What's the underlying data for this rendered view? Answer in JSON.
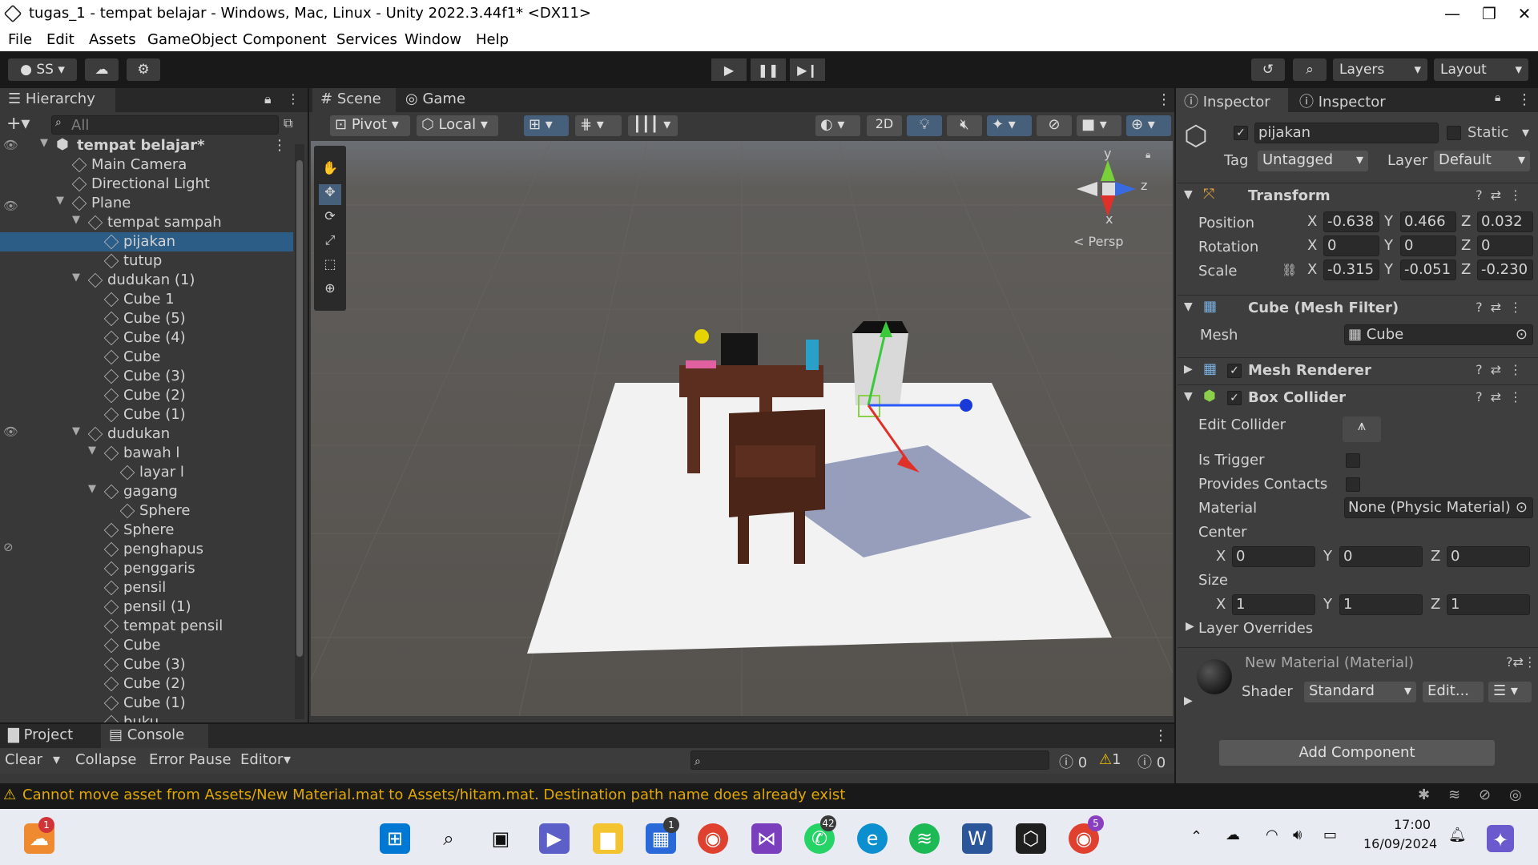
{
  "window": {
    "title": "tugas_1 - tempat belajar - Windows, Mac, Linux - Unity 2022.3.44f1* <DX11>"
  },
  "menu": [
    "File",
    "Edit",
    "Assets",
    "GameObject",
    "Component",
    "Services",
    "Window",
    "Help"
  ],
  "toolbar": {
    "account": "SS",
    "layers": "Layers",
    "layout": "Layout"
  },
  "hierarchy": {
    "tab": "Hierarchy",
    "search_placeholder": "All",
    "scene": "tempat belajar*",
    "items": [
      {
        "label": "Main Camera",
        "depth": 1
      },
      {
        "label": "Directional Light",
        "depth": 1
      },
      {
        "label": "Plane",
        "depth": 1,
        "expanded": true
      },
      {
        "label": "tempat sampah",
        "depth": 2,
        "expanded": true
      },
      {
        "label": "pijakan",
        "depth": 3,
        "selected": true
      },
      {
        "label": "tutup",
        "depth": 3
      },
      {
        "label": "dudukan (1)",
        "depth": 2,
        "expanded": true
      },
      {
        "label": "Cube 1",
        "depth": 3
      },
      {
        "label": "Cube (5)",
        "depth": 3
      },
      {
        "label": "Cube (4)",
        "depth": 3
      },
      {
        "label": "Cube",
        "depth": 3
      },
      {
        "label": "Cube (3)",
        "depth": 3
      },
      {
        "label": "Cube (2)",
        "depth": 3
      },
      {
        "label": "Cube (1)",
        "depth": 3
      },
      {
        "label": "dudukan",
        "depth": 2,
        "expanded": true
      },
      {
        "label": "bawah l",
        "depth": 3,
        "expanded": true
      },
      {
        "label": "layar l",
        "depth": 4
      },
      {
        "label": "gagang",
        "depth": 3,
        "expanded": true
      },
      {
        "label": "Sphere",
        "depth": 4
      },
      {
        "label": "Sphere",
        "depth": 3
      },
      {
        "label": "penghapus",
        "depth": 3
      },
      {
        "label": "penggaris",
        "depth": 3
      },
      {
        "label": "pensil",
        "depth": 3
      },
      {
        "label": "pensil (1)",
        "depth": 3
      },
      {
        "label": "tempat pensil",
        "depth": 3
      },
      {
        "label": "Cube",
        "depth": 3
      },
      {
        "label": "Cube (3)",
        "depth": 3
      },
      {
        "label": "Cube (2)",
        "depth": 3
      },
      {
        "label": "Cube (1)",
        "depth": 3
      },
      {
        "label": "buku",
        "depth": 3
      }
    ]
  },
  "scene_view": {
    "tabs": [
      "Scene",
      "Game"
    ],
    "pivot": "Pivot",
    "local": "Local",
    "mode_2d": "2D",
    "gizmo": {
      "y": "y",
      "z": "z",
      "x": "x",
      "persp": "< Persp"
    }
  },
  "inspector": {
    "tabs": [
      "Inspector",
      "Inspector"
    ],
    "object_name": "pijakan",
    "static_label": "Static",
    "tag_label": "Tag",
    "tag_value": "Untagged",
    "layer_label": "Layer",
    "layer_value": "Default",
    "transform": {
      "title": "Transform",
      "position_label": "Position",
      "rotation_label": "Rotation",
      "scale_label": "Scale",
      "position": {
        "x": "-0.638",
        "y": "0.466",
        "z": "0.032"
      },
      "rotation": {
        "x": "0",
        "y": "0",
        "z": "0"
      },
      "scale": {
        "x": "-0.315",
        "y": "-0.051",
        "z": "-0.230"
      }
    },
    "mesh_filter": {
      "title": "Cube (Mesh Filter)",
      "mesh_label": "Mesh",
      "mesh_value": "Cube"
    },
    "mesh_renderer": {
      "title": "Mesh Renderer"
    },
    "box_collider": {
      "title": "Box Collider",
      "edit_collider": "Edit Collider",
      "is_trigger": "Is Trigger",
      "provides_contacts": "Provides Contacts",
      "material_label": "Material",
      "material_value": "None (Physic Material)",
      "center_label": "Center",
      "center": {
        "x": "0",
        "y": "0",
        "z": "0"
      },
      "size_label": "Size",
      "size": {
        "x": "1",
        "y": "1",
        "z": "1"
      },
      "layer_overrides": "Layer Overrides"
    },
    "material": {
      "title": "New Material (Material)",
      "shader_label": "Shader",
      "shader_value": "Standard",
      "edit_button": "Edit..."
    },
    "add_component": "Add Component",
    "axis_labels": {
      "x": "X",
      "y": "Y",
      "z": "Z"
    }
  },
  "bottom": {
    "tabs": [
      "Project",
      "Console"
    ],
    "clear": "Clear",
    "collapse": "Collapse",
    "error_pause": "Error Pause",
    "editor": "Editor",
    "counts": {
      "info": "0",
      "warn": "1",
      "error": "0"
    },
    "status_message": "Cannot move asset from Assets/New Material.mat to Assets/hitam.mat. Destination path name does already exist"
  },
  "taskbar": {
    "time": "17:00",
    "date": "16/09/2024",
    "badges": {
      "weather": "1",
      "store": "1",
      "whatsapp": "42",
      "chrome2": "5"
    }
  },
  "colors": {
    "selection": "#2c5d87",
    "panel": "#383838",
    "scene_bg": "#5a5652",
    "plane": "#f2f2f2",
    "warning": "#f0c000"
  }
}
